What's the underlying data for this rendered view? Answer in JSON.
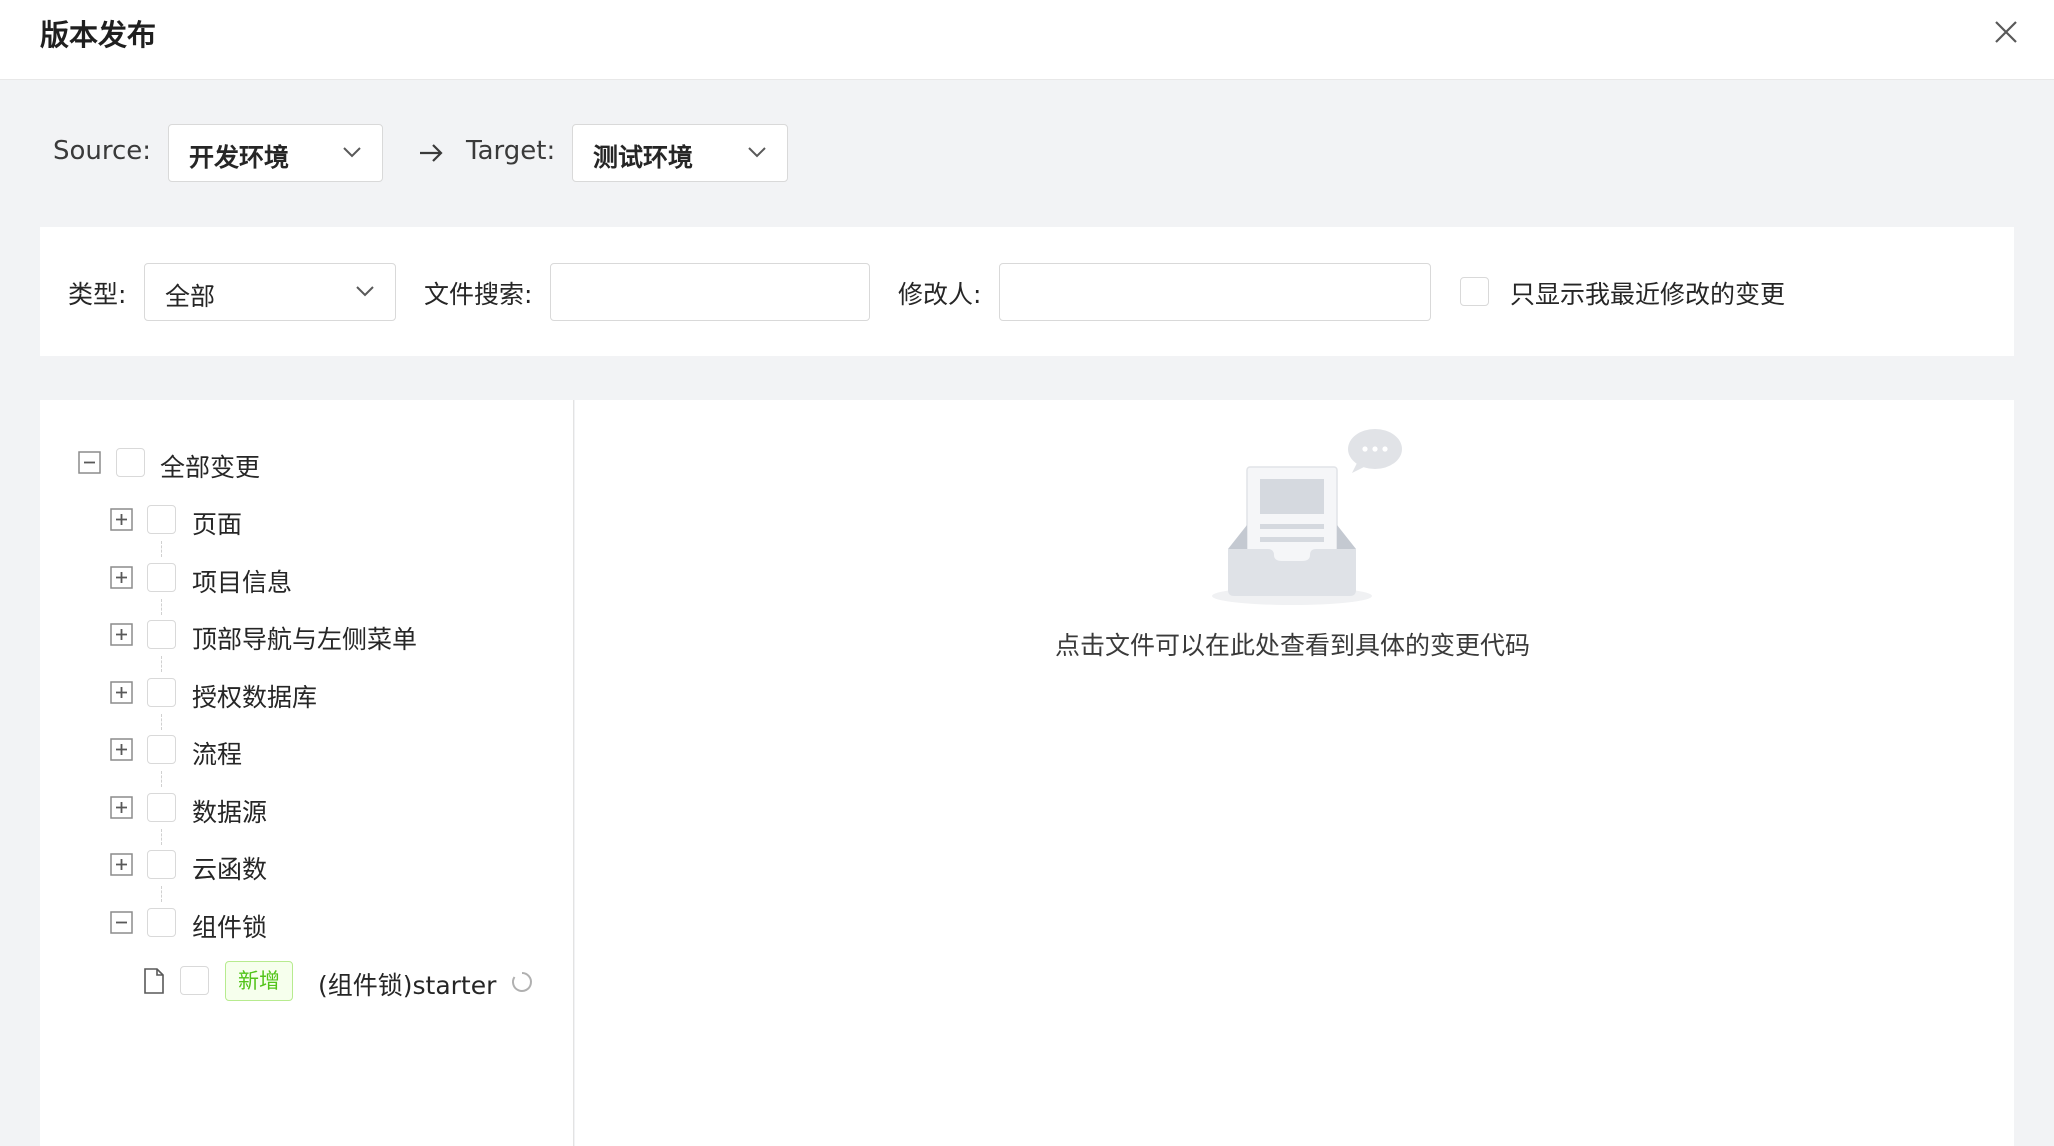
{
  "header": {
    "title": "版本发布"
  },
  "env": {
    "source_label": "Source:",
    "source_value": "开发环境",
    "target_label": "Target:",
    "target_value": "测试环境"
  },
  "filters": {
    "type_label": "类型:",
    "type_value": "全部",
    "file_search_label": "文件搜索:",
    "file_search_value": "",
    "modifier_label": "修改人:",
    "modifier_value": "",
    "only_mine_label": "只显示我最近修改的变更",
    "only_mine_checked": false
  },
  "tree": {
    "root_label": "全部变更",
    "root_expanded": true,
    "children": [
      {
        "label": "页面",
        "expanded": false
      },
      {
        "label": "项目信息",
        "expanded": false
      },
      {
        "label": "顶部导航与左侧菜单",
        "expanded": false
      },
      {
        "label": "授权数据库",
        "expanded": false
      },
      {
        "label": "流程",
        "expanded": false
      },
      {
        "label": "数据源",
        "expanded": false
      },
      {
        "label": "云函数",
        "expanded": false
      },
      {
        "label": "组件锁",
        "expanded": true
      }
    ],
    "leaf": {
      "tag": "新增",
      "label": "(组件锁)starter"
    }
  },
  "detail": {
    "empty_text": "点击文件可以在此处查看到具体的变更代码"
  },
  "colors": {
    "tag_green": "#52c41a",
    "border": "#d9d9d9",
    "page_bg": "#f2f3f5"
  },
  "icons": [
    "close-icon",
    "chevron-down-icon",
    "arrow-right-icon",
    "collapse-icon",
    "expand-icon",
    "file-icon",
    "loading-icon",
    "empty-inbox-icon"
  ]
}
